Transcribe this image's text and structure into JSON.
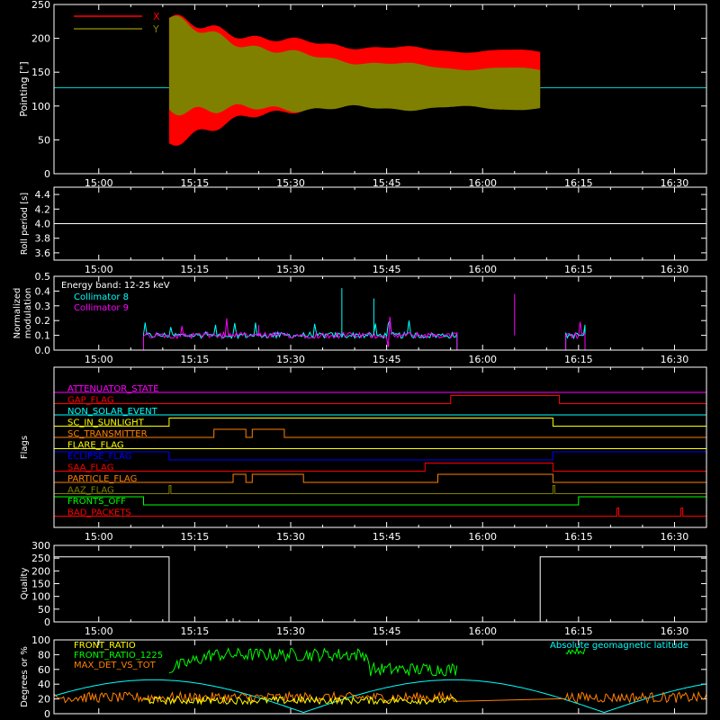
{
  "time_ticks": [
    "15:00",
    "15:15",
    "15:30",
    "15:45",
    "16:00",
    "16:15",
    "16:30"
  ],
  "colors": {
    "background": "#000000",
    "axes": "#ffffff",
    "red": "#ff0000",
    "olive": "#808000",
    "cyan": "#00ffff",
    "magenta": "#ff00ff",
    "green": "#00ff00",
    "orange": "#ff8000",
    "yellow": "#ffff00",
    "blue": "#0000ff",
    "lightgreen": "#00ff00"
  },
  "chart_data": [
    {
      "id": "pointing",
      "type": "line",
      "ylabel": "Pointing [\"]",
      "xlim": [
        "14:53",
        "16:35"
      ],
      "ylim": [
        0,
        250
      ],
      "yticks": [
        "0",
        "50",
        "100",
        "150",
        "200",
        "250"
      ],
      "legend": [
        {
          "name": "X",
          "color": "#ff0000"
        },
        {
          "name": "Y",
          "color": "#808000"
        }
      ],
      "baseline_value": 127,
      "active_range": [
        "15:11",
        "16:09"
      ],
      "series": [
        {
          "name": "X",
          "color": "#ff0000",
          "upper_start": 230,
          "upper_end": 178,
          "lower_start": 45,
          "lower_end": 120
        },
        {
          "name": "Y",
          "color": "#808000",
          "upper_start": 230,
          "upper_end": 150,
          "lower_start": 95,
          "lower_end": 97
        }
      ]
    },
    {
      "id": "roll",
      "type": "line",
      "ylabel": "Roll period [s]",
      "ylim": [
        3.5,
        4.5
      ],
      "yticks": [
        "3.6",
        "3.8",
        "4.0",
        "4.2",
        "4.4"
      ],
      "series": [
        {
          "name": "roll",
          "value": 4.0,
          "color": "#ffffff"
        }
      ]
    },
    {
      "id": "modulation",
      "type": "line",
      "ylabel": "Normalized modulation",
      "ylim": [
        0,
        0.5
      ],
      "yticks": [
        "0.0",
        "0.1",
        "0.2",
        "0.3",
        "0.4",
        "0.5"
      ],
      "legend_title": "Energy band: 12-25 keV",
      "legend": [
        {
          "name": "Collimator 8",
          "color": "#00ffff"
        },
        {
          "name": "Collimator 9",
          "color": "#ff00ff"
        }
      ],
      "active_ranges": [
        [
          "15:07",
          "15:56"
        ],
        [
          "16:13",
          "16:16"
        ]
      ],
      "typical_value": 0.1
    },
    {
      "id": "flags",
      "type": "line",
      "ylabel": "Flags",
      "flags": [
        {
          "name": "ATTENUATOR_STATE",
          "color": "#ff00ff",
          "high": []
        },
        {
          "name": "GAP_FLAG",
          "color": "#ff0000",
          "high": [
            [
              "15:55",
              "16:12"
            ]
          ]
        },
        {
          "name": "NON_SOLAR_EVENT",
          "color": "#00ffff",
          "high": []
        },
        {
          "name": "SC_IN_SUNLIGHT",
          "color": "#ffff00",
          "high": [
            [
              "15:11",
              "16:11"
            ]
          ]
        },
        {
          "name": "SC_TRANSMITTER",
          "color": "#ff8000",
          "high": [
            [
              "15:18",
              "15:23"
            ],
            [
              "15:24",
              "15:29"
            ]
          ]
        },
        {
          "name": "FLARE_FLAG",
          "color": "#ffff00",
          "high": []
        },
        {
          "name": "ECLIPSE_FLAG",
          "color": "#0000ff",
          "high": [
            [
              "14:53",
              "15:11"
            ],
            [
              "16:11",
              "16:35"
            ]
          ]
        },
        {
          "name": "SAA_FLAG",
          "color": "#ff0000",
          "high": [
            [
              "15:51",
              "16:11"
            ]
          ]
        },
        {
          "name": "PARTICLE_FLAG",
          "color": "#ff8000",
          "high": [
            [
              "15:21",
              "15:23"
            ],
            [
              "15:24",
              "15:32"
            ],
            [
              "15:53",
              "16:11"
            ]
          ]
        },
        {
          "name": "AAZ_FLAG",
          "color": "#808000",
          "high": [
            [
              "15:11",
              "15:11"
            ],
            [
              "16:11",
              "16:11"
            ]
          ]
        },
        {
          "name": "FRONTS_OFF",
          "color": "#00ff00",
          "high": [
            [
              "14:53",
              "15:07"
            ],
            [
              "16:15",
              "16:35"
            ]
          ]
        },
        {
          "name": "BAD_PACKETS",
          "color": "#ff0000",
          "high": [
            [
              "16:21",
              "16:21"
            ],
            [
              "16:31",
              "16:31"
            ]
          ]
        }
      ]
    },
    {
      "id": "quality",
      "type": "line",
      "ylabel": "Quality",
      "ylim": [
        0,
        300
      ],
      "yticks": [
        "0",
        "50",
        "100",
        "150",
        "200",
        "250",
        "300"
      ],
      "high_value": 255,
      "high_ranges": [
        [
          "14:53",
          "15:11"
        ],
        [
          "16:09",
          "16:35"
        ]
      ]
    },
    {
      "id": "ratios",
      "type": "line",
      "ylabel": "Degrees or %",
      "ylim": [
        0,
        100
      ],
      "yticks": [
        "0",
        "20",
        "40",
        "60",
        "80",
        "100"
      ],
      "legend": [
        {
          "name": "FRONT_RATIO",
          "color": "#ffff00"
        },
        {
          "name": "FRONT_RATIO_1225",
          "color": "#00ff00"
        },
        {
          "name": "MAX_DET_VS_TOT",
          "color": "#ff8000"
        }
      ],
      "annotation": {
        "text": "Absolute geomagnetic latitude",
        "color": "#00ffff"
      }
    }
  ]
}
